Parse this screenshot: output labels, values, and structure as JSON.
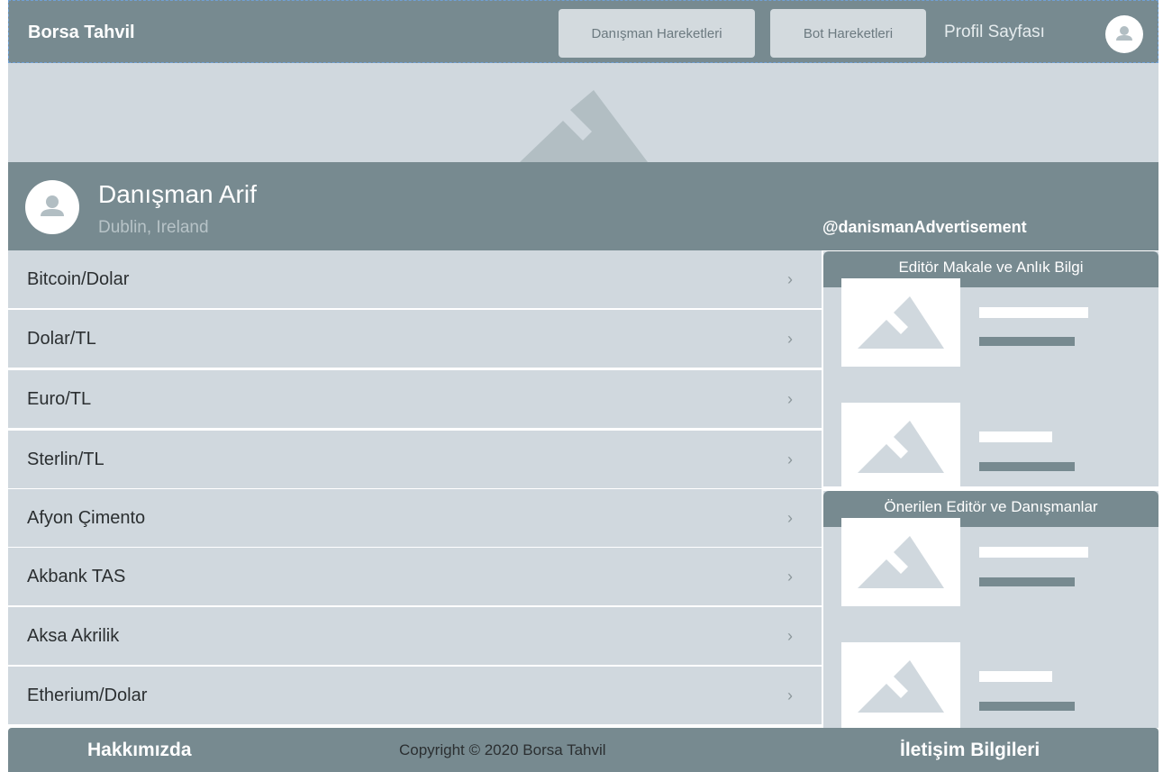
{
  "header": {
    "brand": "Borsa Tahvil",
    "nav": {
      "consultant_moves": "Danışman Hareketleri",
      "bot_moves": "Bot Hareketleri",
      "profile": "Profil Sayfası"
    }
  },
  "profile": {
    "name": "Danışman Arif",
    "location": "Dublin, Ireland",
    "handle": "@danismanAdvertisement"
  },
  "list": {
    "items": [
      {
        "label": "Bitcoin/Dolar"
      },
      {
        "label": "Dolar/TL"
      },
      {
        "label": "Euro/TL"
      },
      {
        "label": "Sterlin/TL"
      },
      {
        "label": "Afyon Çimento"
      },
      {
        "label": "Akbank TAS"
      },
      {
        "label": "Aksa Akrilik"
      },
      {
        "label": "Etherium/Dolar"
      }
    ],
    "chevron": "›"
  },
  "panels": {
    "articles": {
      "title": "Editör Makale ve Anlık Bilgi"
    },
    "recommended": {
      "title": "Önerilen Editör ve Danışmanlar"
    }
  },
  "footer": {
    "about": "Hakkımızda",
    "copyright": "Copyright © 2020 Borsa Tahvil",
    "contact": "İletişim Bilgileri"
  },
  "colors": {
    "primary": "#778a90",
    "light": "#d0d8de",
    "button": "#d3dade",
    "placeholder": "#b2bec3"
  },
  "icons": {
    "avatar": "user-avatar-icon",
    "image": "image-placeholder-icon",
    "chevron": "chevron-right-icon"
  }
}
